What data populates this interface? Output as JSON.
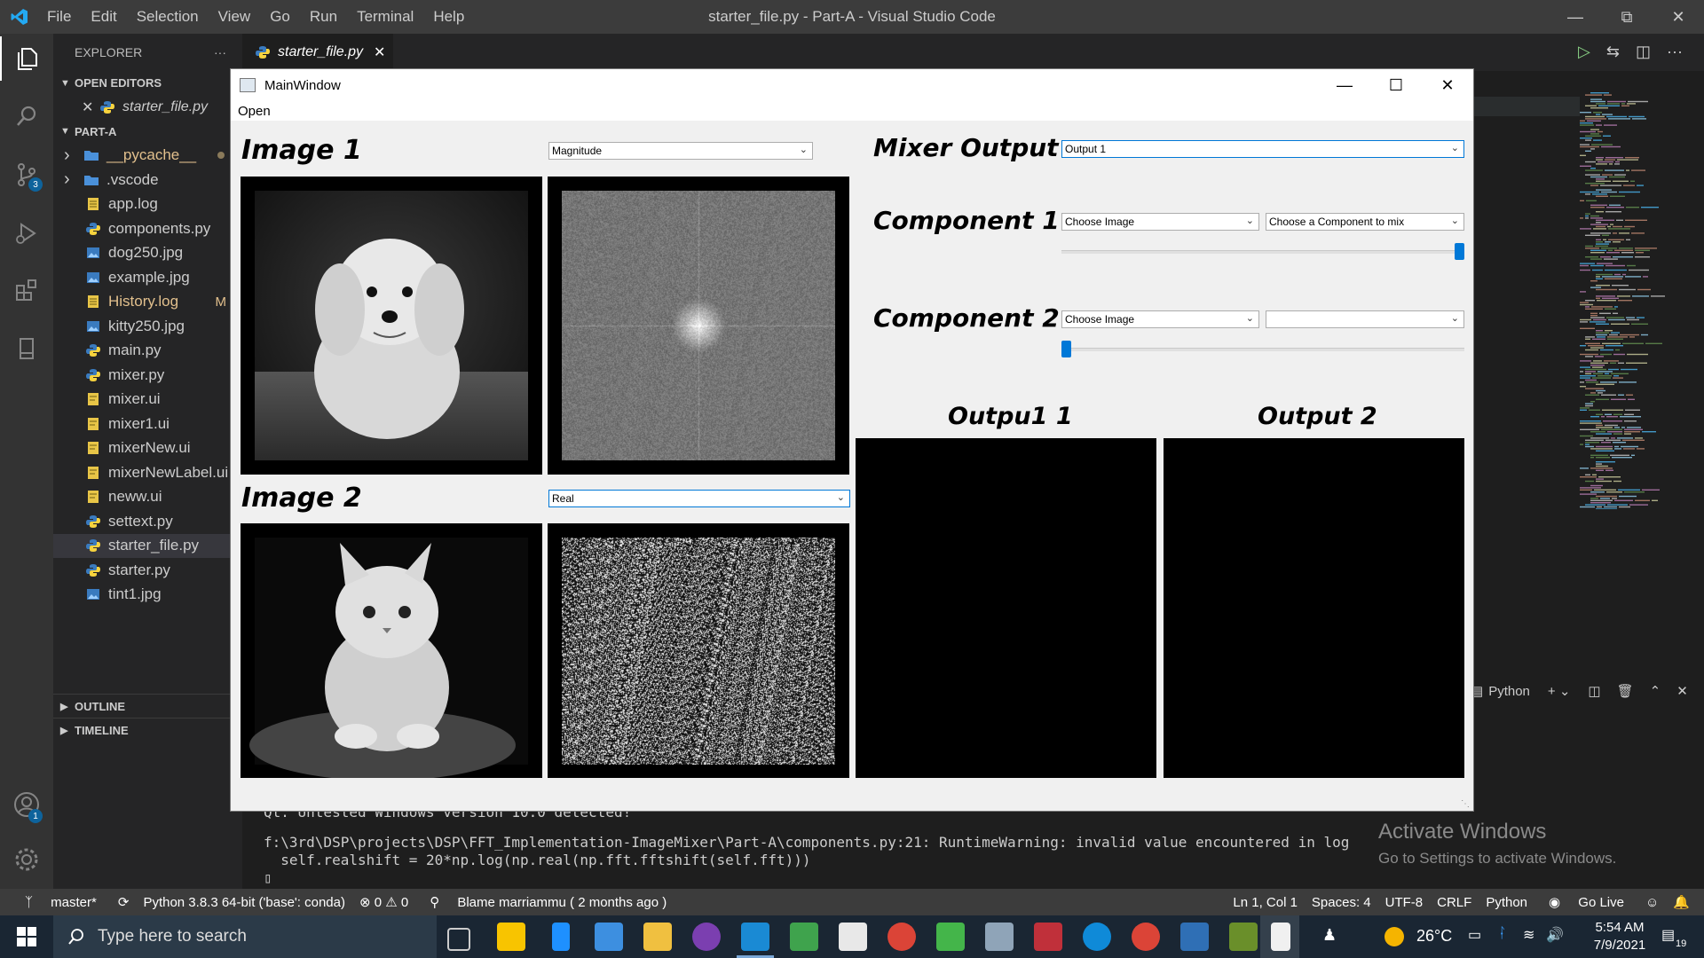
{
  "vscode": {
    "menu": [
      "File",
      "Edit",
      "Selection",
      "View",
      "Go",
      "Run",
      "Terminal",
      "Help"
    ],
    "window_title": "starter_file.py - Part-A - Visual Studio Code",
    "explorer_label": "EXPLORER",
    "open_editors_label": "OPEN EDITORS",
    "open_editor_file": "starter_file.py",
    "folder_label": "PART-A",
    "files": [
      {
        "name": "__pycache__",
        "kind": "folder",
        "color": "#e2c08d"
      },
      {
        "name": ".vscode",
        "kind": "folder",
        "color": "#cccccc"
      },
      {
        "name": "app.log",
        "kind": "log",
        "color": "#cccccc"
      },
      {
        "name": "components.py",
        "kind": "py",
        "color": "#cccccc"
      },
      {
        "name": "dog250.jpg",
        "kind": "img",
        "color": "#cccccc"
      },
      {
        "name": "example.jpg",
        "kind": "img",
        "color": "#cccccc"
      },
      {
        "name": "History.log",
        "kind": "log",
        "color": "#e2c08d",
        "badge": "M"
      },
      {
        "name": "kitty250.jpg",
        "kind": "img",
        "color": "#cccccc"
      },
      {
        "name": "main.py",
        "kind": "py",
        "color": "#cccccc"
      },
      {
        "name": "mixer.py",
        "kind": "py",
        "color": "#cccccc"
      },
      {
        "name": "mixer.ui",
        "kind": "ui",
        "color": "#cccccc"
      },
      {
        "name": "mixer1.ui",
        "kind": "ui",
        "color": "#cccccc"
      },
      {
        "name": "mixerNew.ui",
        "kind": "ui",
        "color": "#cccccc"
      },
      {
        "name": "mixerNewLabel.ui",
        "kind": "ui",
        "color": "#cccccc"
      },
      {
        "name": "neww.ui",
        "kind": "ui",
        "color": "#cccccc"
      },
      {
        "name": "settext.py",
        "kind": "py",
        "color": "#cccccc"
      },
      {
        "name": "starter_file.py",
        "kind": "py",
        "color": "#cccccc",
        "selected": true
      },
      {
        "name": "starter.py",
        "kind": "py",
        "color": "#cccccc"
      },
      {
        "name": "tint1.jpg",
        "kind": "img",
        "color": "#cccccc"
      }
    ],
    "outline_label": "OUTLINE",
    "timeline_label": "TIMELINE",
    "tab_label": "starter_file.py",
    "scm_badge": "3",
    "accounts_badge": "1",
    "panel_python": "Python",
    "terminal_lines": [
      "Qt: Untested Windows version 10.0 detected!",
      "f:\\3rd\\DSP\\projects\\DSP\\FFT_Implementation-ImageMixer\\Part-A\\components.py:21: RuntimeWarning: invalid value encountered in log",
      "  self.realshift = 20*np.log(np.real(np.fft.fftshift(self.fft)))"
    ],
    "terminal_prompt": "▯",
    "watermark_title": "Activate Windows",
    "watermark_sub": "Go to Settings to activate Windows.",
    "status": {
      "branch": "master*",
      "python": "Python 3.8.3 64-bit ('base': conda)",
      "problems": "⊗ 0 ⚠ 0",
      "blame": "Blame marriammu ( 2 months ago )",
      "position": "Ln 1, Col 1",
      "spaces": "Spaces: 4",
      "encoding": "UTF-8",
      "eol": "CRLF",
      "language": "Python",
      "golive": "Go Live"
    }
  },
  "taskbar": {
    "search_placeholder": "Type here to search",
    "temperature": "26°C",
    "time": "5:54 AM",
    "date": "7/9/2021",
    "notification_count": "19"
  },
  "qt": {
    "window_title": "MainWindow",
    "menu_open": "Open",
    "image1_label": "Image 1",
    "image2_label": "Image 2",
    "image1_combo": "Magnitude",
    "image2_combo": "Real",
    "mixer_output_label": "Mixer Output",
    "mixer_output_combo": "Output 1",
    "component1_label": "Component 1",
    "component2_label": "Component 2",
    "comp1_image_combo": "Choose Image",
    "comp1_component_combo": "Choose a Component to mix",
    "comp2_image_combo": "Choose Image",
    "comp2_component_combo": "",
    "comp1_slider_value": 1.0,
    "comp2_slider_value": 0.0,
    "output1_label": "Outpu1 1",
    "output2_label": "Output 2"
  },
  "colors": {
    "accent": "#0078d7",
    "vscode_blue": "#007acc",
    "badge_blue": "#0e639c"
  }
}
